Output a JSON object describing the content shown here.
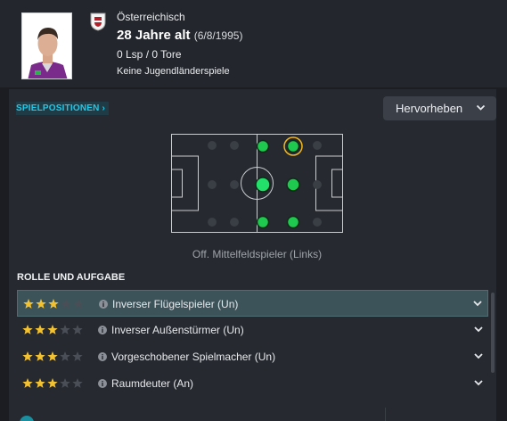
{
  "header": {
    "nationality": "Österreichisch",
    "age": "28 Jahre alt",
    "dob": "(6/8/1995)",
    "caps": "0 Lsp / 0 Tore",
    "youth": "Keine Jugendländerspiele"
  },
  "positions": {
    "link_label": "SPIELPOSITIONEN ›",
    "highlight_button": "Hervorheben",
    "selected_position": "Off. Mittelfeldspieler (Links)"
  },
  "roles": {
    "heading": "ROLLE UND AUFGABE",
    "items": [
      {
        "label": "Inverser Flügelspieler (Un)",
        "stars": 3,
        "max_stars": 5,
        "selected": true
      },
      {
        "label": "Inverser Außenstürmer (Un)",
        "stars": 3,
        "max_stars": 5,
        "selected": false
      },
      {
        "label": "Vorgeschobener Spielmacher (Un)",
        "stars": 3,
        "max_stars": 5,
        "selected": false
      },
      {
        "label": "Raumdeuter (An)",
        "stars": 3,
        "max_stars": 5,
        "selected": false
      }
    ]
  },
  "colors": {
    "accent": "#24c7e6",
    "star": "#f2c233",
    "position_green": "#1fd35a",
    "highlight_ring": "#f0b71f"
  }
}
